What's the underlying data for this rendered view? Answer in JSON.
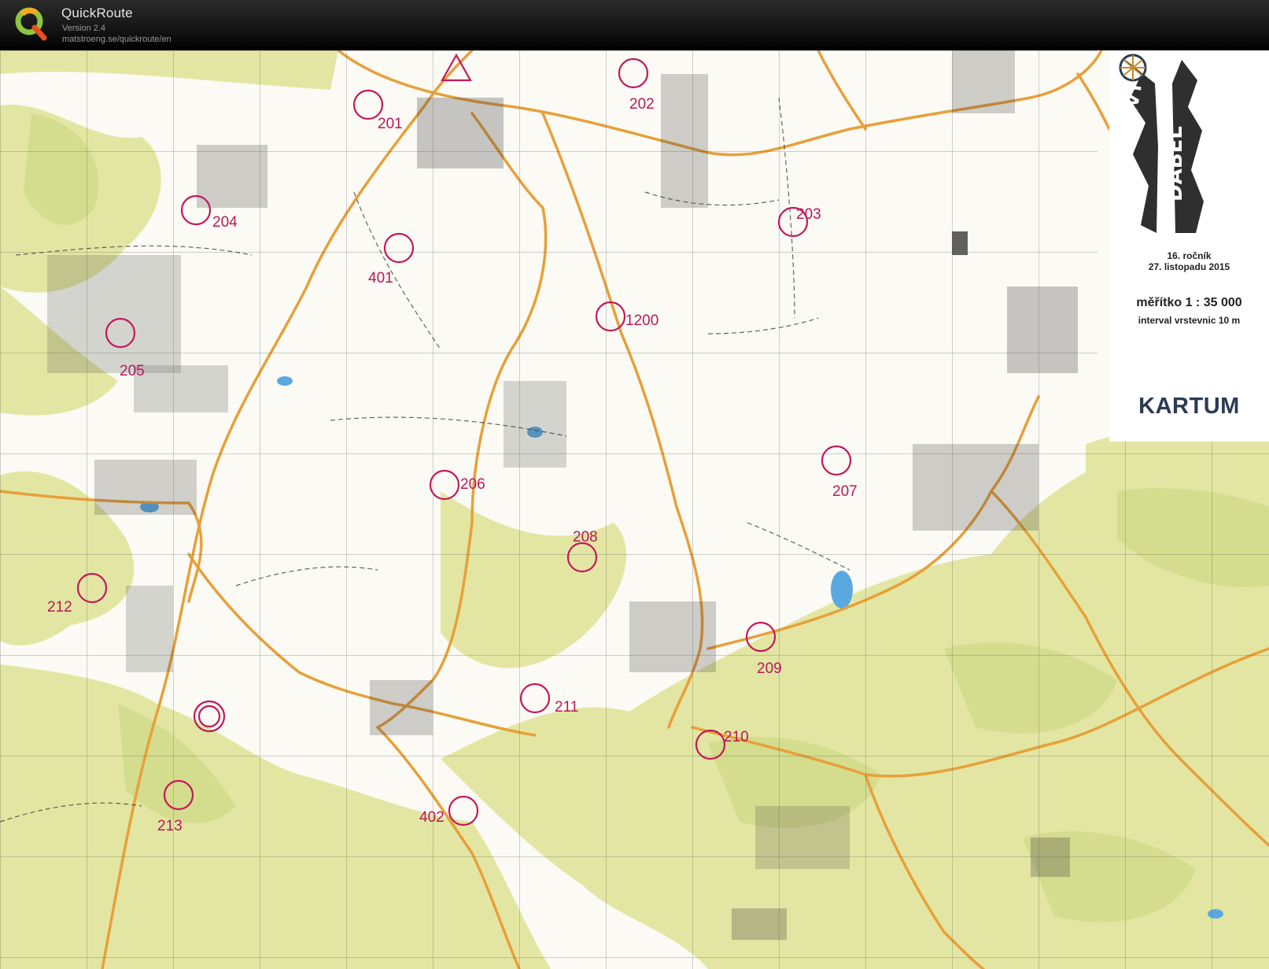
{
  "app": {
    "title": "QuickRoute",
    "version": "Version 2.4",
    "url": "matstroeng.se/quickroute/en"
  },
  "map_legend": {
    "event_title_line1": "MRAZIVÝ",
    "event_title_line2": "ĎÁBEL",
    "edition": "16. ročník",
    "date": "27. listopadu 2015",
    "scale": "měřítko 1 : 35 000",
    "contour_interval": "interval vrstevnic 10 m",
    "publisher": "KARTUM"
  },
  "colors": {
    "control_circle": "#c2185b",
    "forest": "#e4e6a4",
    "forest_dark": "#cdd789",
    "road": "#e8a033",
    "grid": "#444444",
    "water": "#4a9bd8",
    "building": "#333333"
  },
  "controls": [
    {
      "code": "201"
    },
    {
      "code": "202"
    },
    {
      "code": "203"
    },
    {
      "code": "204"
    },
    {
      "code": "205"
    },
    {
      "code": "401"
    },
    {
      "code": "1200"
    },
    {
      "code": "206"
    },
    {
      "code": "207"
    },
    {
      "code": "208"
    },
    {
      "code": "212"
    },
    {
      "code": "209"
    },
    {
      "code": "211"
    },
    {
      "code": "210"
    },
    {
      "code": "213"
    },
    {
      "code": "402"
    }
  ]
}
